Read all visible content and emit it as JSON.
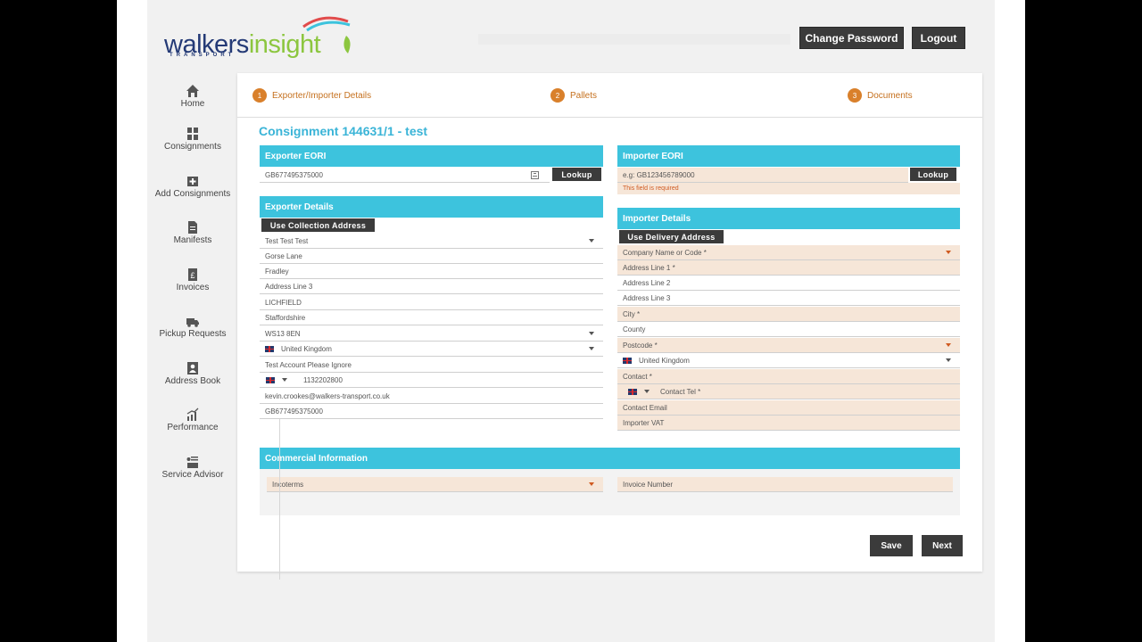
{
  "header": {
    "logo_word_1": "walkers",
    "logo_word_2": "insight",
    "logo_sub": "TRANSPORT",
    "change_password": "Change Password",
    "logout": "Logout"
  },
  "sidebar": {
    "items": [
      {
        "label": "Home",
        "icon": "home-icon"
      },
      {
        "label": "Consignments",
        "icon": "boxes-icon"
      },
      {
        "label": "Add Consignments",
        "icon": "add-box-icon"
      },
      {
        "label": "Manifests",
        "icon": "document-icon"
      },
      {
        "label": "Invoices",
        "icon": "invoice-icon"
      },
      {
        "label": "Pickup Requests",
        "icon": "truck-icon"
      },
      {
        "label": "Address Book",
        "icon": "address-book-icon"
      },
      {
        "label": "Performance",
        "icon": "chart-icon"
      },
      {
        "label": "Service Advisor",
        "icon": "advisor-icon"
      }
    ]
  },
  "steps": [
    {
      "num": "1",
      "label": "Exporter/Importer Details"
    },
    {
      "num": "2",
      "label": "Pallets"
    },
    {
      "num": "3",
      "label": "Documents"
    }
  ],
  "page_title": "Consignment 144631/1 - test",
  "exporter_eori": {
    "title": "Exporter EORI",
    "value": "GB677495375000",
    "lookup": "Lookup"
  },
  "importer_eori": {
    "title": "Importer EORI",
    "placeholder": "e.g: GB123456789000",
    "error": "This field is required",
    "lookup": "Lookup"
  },
  "exporter_details": {
    "title": "Exporter Details",
    "use_address_btn": "Use Collection Address",
    "company": "Test Test Test",
    "address1": "Gorse Lane",
    "address2": "Fradley",
    "address3": "Address Line 3",
    "city": "LICHFIELD",
    "county": "Staffordshire",
    "postcode": "WS13 8EN",
    "country": "United Kingdom",
    "contact": "Test Account Please Ignore",
    "phone": "1132202800",
    "email": "kevin.crookes@walkers-transport.co.uk",
    "vat": "GB677495375000"
  },
  "importer_details": {
    "title": "Importer Details",
    "use_address_btn": "Use Delivery Address",
    "company": "Company Name or Code *",
    "address1": "Address Line 1 *",
    "address2": "Address Line 2",
    "address3": "Address Line 3",
    "city": "City *",
    "county": "County",
    "postcode": "Postcode *",
    "country": "United Kingdom",
    "contact": "Contact *",
    "phone": "Contact Tel *",
    "email": "Contact Email",
    "vat": "Importer VAT"
  },
  "commercial": {
    "title": "Commercial Information",
    "incoterms": "Incoterms",
    "invoice_number": "Invoice Number"
  },
  "footer": {
    "save": "Save",
    "next": "Next"
  },
  "colors": {
    "accent": "#3dc3dd",
    "title": "#3ab4d7",
    "step": "#d9802b",
    "required_bg": "#f6e6d8",
    "button": "#3b3b3b"
  }
}
